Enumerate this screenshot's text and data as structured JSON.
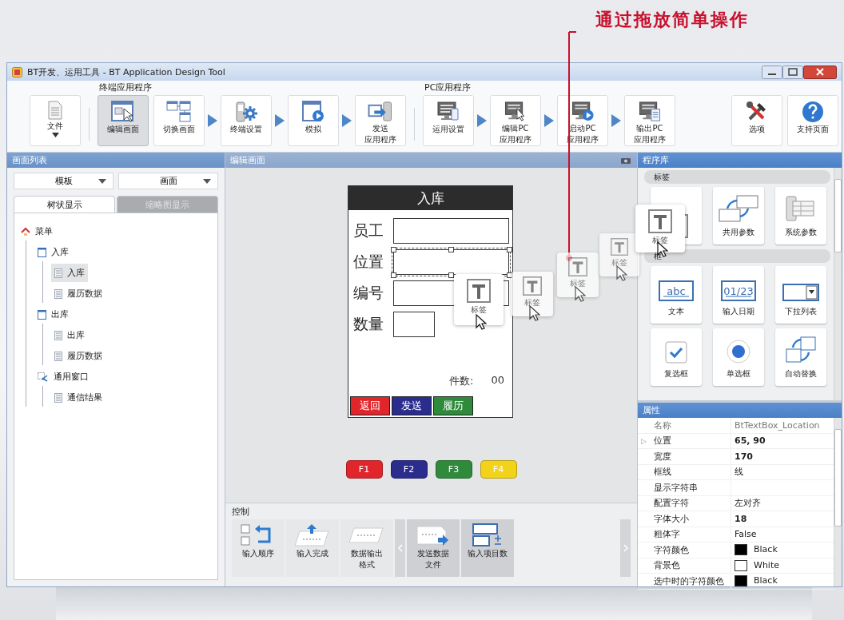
{
  "callout": {
    "text": "通过拖放简单操作"
  },
  "window": {
    "title": "BT开发、运用工具 - BT Application Design Tool"
  },
  "ribbon": {
    "sections": [
      {
        "items": [
          {
            "kind": "menu",
            "label": "文件"
          }
        ]
      },
      {
        "label": "终端应用程序",
        "items": [
          {
            "kind": "button",
            "label": "编辑画面",
            "selected": true
          },
          {
            "kind": "button",
            "label": "切换画面",
            "selected": false
          },
          {
            "kind": "step"
          },
          {
            "kind": "button",
            "label": "终端设置",
            "selected": false
          },
          {
            "kind": "step"
          },
          {
            "kind": "button",
            "label": "模拟",
            "selected": false
          },
          {
            "kind": "step"
          },
          {
            "kind": "button",
            "lines": [
              "发送",
              "应用程序"
            ],
            "selected": false
          }
        ]
      },
      {
        "label": "PC应用程序",
        "items": [
          {
            "kind": "button",
            "label": "运用设置",
            "selected": false
          },
          {
            "kind": "step"
          },
          {
            "kind": "button",
            "lines": [
              "编辑PC",
              "应用程序"
            ],
            "selected": false
          },
          {
            "kind": "step"
          },
          {
            "kind": "button",
            "lines": [
              "启动PC",
              "应用程序"
            ],
            "selected": false
          },
          {
            "kind": "step"
          },
          {
            "kind": "button",
            "lines": [
              "输出PC",
              "应用程序"
            ],
            "selected": false
          }
        ]
      },
      {
        "items": [
          {
            "kind": "button",
            "label": "选项",
            "selected": false
          },
          {
            "kind": "button",
            "label": "支持页面",
            "selected": false
          }
        ]
      }
    ]
  },
  "screen_list": {
    "title": "画面列表",
    "dropdowns": [
      "模板",
      "画面"
    ],
    "tabs": [
      {
        "label": "树状显示",
        "selected": true
      },
      {
        "label": "缩略图显示",
        "selected": false
      }
    ],
    "tree": [
      {
        "kind": "menu",
        "label": "菜单",
        "selected": false,
        "children": [
          {
            "kind": "screen",
            "label": "入库",
            "selected": false,
            "children": [
              {
                "kind": "page",
                "label": "入库",
                "selected": true
              },
              {
                "kind": "page",
                "label": "履历数据",
                "selected": false
              }
            ]
          },
          {
            "kind": "screen",
            "label": "出库",
            "selected": false,
            "children": [
              {
                "kind": "page",
                "label": "出库",
                "selected": false
              },
              {
                "kind": "page",
                "label": "履历数据",
                "selected": false
              }
            ]
          },
          {
            "kind": "window",
            "label": "通用窗口",
            "selected": false,
            "children": [
              {
                "kind": "page",
                "label": "通信结果",
                "selected": false
              }
            ]
          }
        ]
      }
    ]
  },
  "editor": {
    "title": "编辑画面",
    "device": {
      "title": "入库",
      "fields": [
        {
          "label": "员工",
          "kind": "wide",
          "selected": false
        },
        {
          "label": "位置",
          "kind": "wide",
          "selected": true
        },
        {
          "label": "编号",
          "kind": "wide",
          "selected": false
        },
        {
          "label": "数量",
          "kind": "short",
          "selected": false
        }
      ],
      "count": {
        "label": "件数:",
        "value": "00"
      },
      "buttons": [
        {
          "label": "返回",
          "color": "#e0252b"
        },
        {
          "label": "发送",
          "color": "#2b2d8c"
        },
        {
          "label": "履历",
          "color": "#2f8a3c"
        }
      ]
    },
    "function_keys": [
      {
        "label": "F1",
        "color": "#e0252b"
      },
      {
        "label": "F2",
        "color": "#2b2d8c"
      },
      {
        "label": "F3",
        "color": "#2f8a3c"
      },
      {
        "label": "F4",
        "color": "#f3d21a"
      }
    ],
    "controls": {
      "title": "控制",
      "items": [
        {
          "label": "输入顺序",
          "selected": false
        },
        {
          "label": "输入完成",
          "selected": false
        },
        {
          "lines": [
            "数据输出",
            "格式"
          ],
          "selected": false
        },
        {
          "lines": [
            "发送数据",
            "文件"
          ],
          "selected": true
        },
        {
          "label": "输入项目数",
          "selected": true
        }
      ]
    }
  },
  "library": {
    "title": "程序库",
    "sections": [
      {
        "label": "标签",
        "items": [
          {
            "kind": "label"
          },
          {
            "kind": "shared",
            "label": "共用参数"
          },
          {
            "kind": "system",
            "label": "系统参数"
          }
        ]
      },
      {
        "label": "框",
        "items": [
          {
            "kind": "text",
            "icon_text": "abc",
            "label": "文本"
          },
          {
            "kind": "date",
            "icon_text": "01/23",
            "label": "输入日期"
          },
          {
            "kind": "dropdown",
            "label": "下拉列表"
          },
          {
            "kind": "checkbox",
            "label": "复选框"
          },
          {
            "kind": "radio",
            "label": "单选框"
          },
          {
            "kind": "replace",
            "label": "自动替换"
          }
        ]
      }
    ]
  },
  "properties": {
    "title": "属性",
    "rows": [
      {
        "kind": "text",
        "name": "名称",
        "value": "BtTextBox_Location",
        "bold": false,
        "disabled": true
      },
      {
        "kind": "text",
        "name": "位置",
        "value": "65, 90",
        "bold": true,
        "disabled": false,
        "expander": "▷"
      },
      {
        "kind": "text",
        "name": "宽度",
        "value": "170",
        "bold": true,
        "disabled": false
      },
      {
        "kind": "text",
        "name": "框线",
        "value": "线",
        "bold": false,
        "disabled": false
      },
      {
        "kind": "text",
        "name": "显示字符串",
        "bold": false,
        "disabled": false
      },
      {
        "kind": "text",
        "name": "配置字符",
        "value": "左对齐",
        "bold": false,
        "disabled": false
      },
      {
        "kind": "text",
        "name": "字体大小",
        "value": "18",
        "bold": true,
        "disabled": false
      },
      {
        "kind": "text",
        "name": "粗体字",
        "value": "False",
        "bold": false,
        "disabled": false
      },
      {
        "kind": "color",
        "name": "字符颜色",
        "value": "Black",
        "color": "#000000",
        "bold": false,
        "disabled": false
      },
      {
        "kind": "color",
        "name": "背景色",
        "value": "White",
        "color": "#ffffff",
        "bold": false,
        "disabled": false
      },
      {
        "kind": "color",
        "name": "选中时的字符颜色",
        "value": "Black",
        "color": "#000000",
        "bold": false,
        "disabled": false
      }
    ]
  },
  "drag_ghosts": [
    {
      "label": "标签"
    },
    {
      "label": "标签"
    },
    {
      "label": "标签"
    },
    {
      "label": "标签"
    },
    {
      "label": "标签"
    }
  ]
}
